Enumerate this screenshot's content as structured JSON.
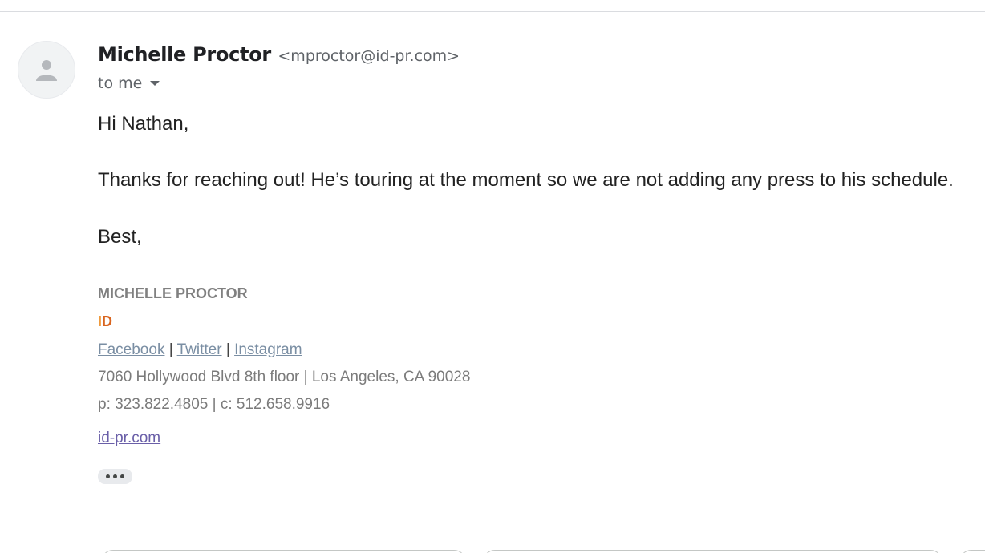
{
  "message": {
    "sender_name": "Michelle Proctor",
    "sender_email": "<mproctor@id-pr.com>",
    "recipient_label": "to me",
    "greeting": "Hi Nathan,",
    "body": "Thanks for reaching out! He’s touring at the moment so we are not adding any press to his schedule.",
    "closing": "Best,"
  },
  "signature": {
    "name": "MICHELLE PROCTOR",
    "company_letters": [
      "I",
      "D"
    ],
    "links": [
      "Facebook",
      "Twitter",
      "Instagram"
    ],
    "link_separator": "|",
    "address": "7060 Hollywood Blvd 8th floor | Los Angeles, CA 90028",
    "phones": "p: 323.822.4805 | c: 512.658.9916",
    "website": "id-pr.com"
  },
  "icons": {
    "avatar": "person-icon",
    "recipient_details": "caret-down-icon",
    "show_trimmed": "more-dots-icon"
  },
  "colors": {
    "company_i": "#ef9a3d",
    "company_d": "#d9641e",
    "link": "#7a8ea3",
    "website_link": "#6a5fa8"
  }
}
